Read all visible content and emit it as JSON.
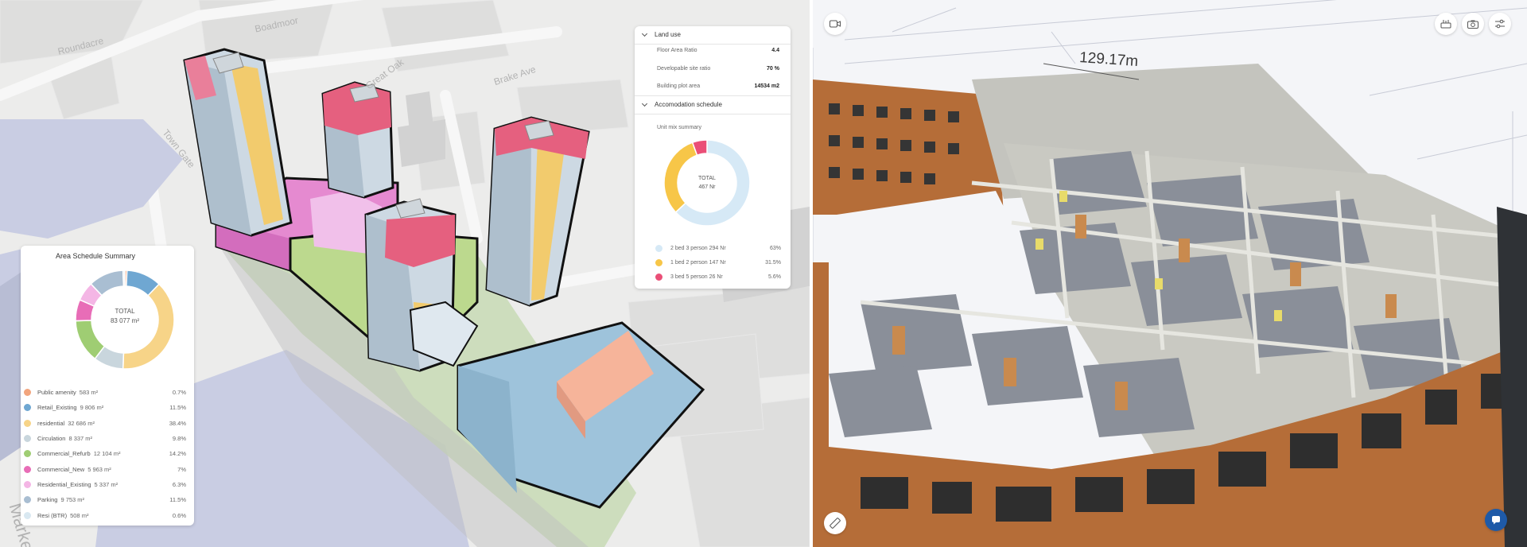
{
  "map": {
    "street_labels": [
      "Roundacre",
      "Boadmoor",
      "Great Oak",
      "Brake Ave",
      "Town Gate",
      "Marke"
    ]
  },
  "area_schedule": {
    "title": "Area Schedule Summary",
    "total_label": "TOTAL",
    "total_value": "83 077 m²",
    "items": [
      {
        "name": "Public amenity",
        "area": "583 m²",
        "pct": "0.7%",
        "color": "#f2a57e",
        "share": 0.7
      },
      {
        "name": "Retail_Existing",
        "area": "9 806 m²",
        "pct": "11.5%",
        "color": "#6fa7d2",
        "share": 11.5
      },
      {
        "name": "residential",
        "area": "32 686 m²",
        "pct": "38.4%",
        "color": "#f7d488",
        "share": 38.4
      },
      {
        "name": "Circulation",
        "area": "8 337 m²",
        "pct": "9.8%",
        "color": "#c9d6dd",
        "share": 9.8
      },
      {
        "name": "Commercial_Refurb",
        "area": "12 104 m²",
        "pct": "14.2%",
        "color": "#9fcd73",
        "share": 14.2
      },
      {
        "name": "Commercial_New",
        "area": "5 963 m²",
        "pct": "7%",
        "color": "#e86db7",
        "share": 7
      },
      {
        "name": "Residential_Existing",
        "area": "5 337 m²",
        "pct": "6.3%",
        "color": "#f4b6e5",
        "share": 6.3
      },
      {
        "name": "Parking",
        "area": "9 753 m²",
        "pct": "11.5%",
        "color": "#a9bed2",
        "share": 11.5
      },
      {
        "name": "Resi (BTR)",
        "area": "508 m²",
        "pct": "0.6%",
        "color": "#d9e8f1",
        "share": 0.6
      }
    ]
  },
  "land_use": {
    "title": "Land use",
    "rows": [
      {
        "label": "Floor Area Ratio",
        "value": "4.4"
      },
      {
        "label": "Developable site ratio",
        "value": "70 %"
      },
      {
        "label": "Building plot area",
        "value": "14534 m2"
      }
    ]
  },
  "accommodation": {
    "title": "Accomodation schedule",
    "subtitle": "Unit mix summary",
    "total_label": "TOTAL",
    "total_value": "467 Nr",
    "items": [
      {
        "name": "2 bed 3 person",
        "count": "294 Nr",
        "pct": "63%",
        "color": "#d6e9f6",
        "share": 63
      },
      {
        "name": "1 bed 2 person",
        "count": "147 Nr",
        "pct": "31.5%",
        "color": "#f7c648",
        "share": 31.5
      },
      {
        "name": "3 bed 5 person",
        "count": "26 Nr",
        "pct": "5.6%",
        "color": "#ea4f77",
        "share": 5.5
      }
    ]
  },
  "viewer": {
    "measurement": "129.17m",
    "controls": [
      "video-camera-icon",
      "walkthrough-icon",
      "camera-icon",
      "settings-sliders-icon",
      "ruler-icon",
      "chat-icon"
    ]
  }
}
